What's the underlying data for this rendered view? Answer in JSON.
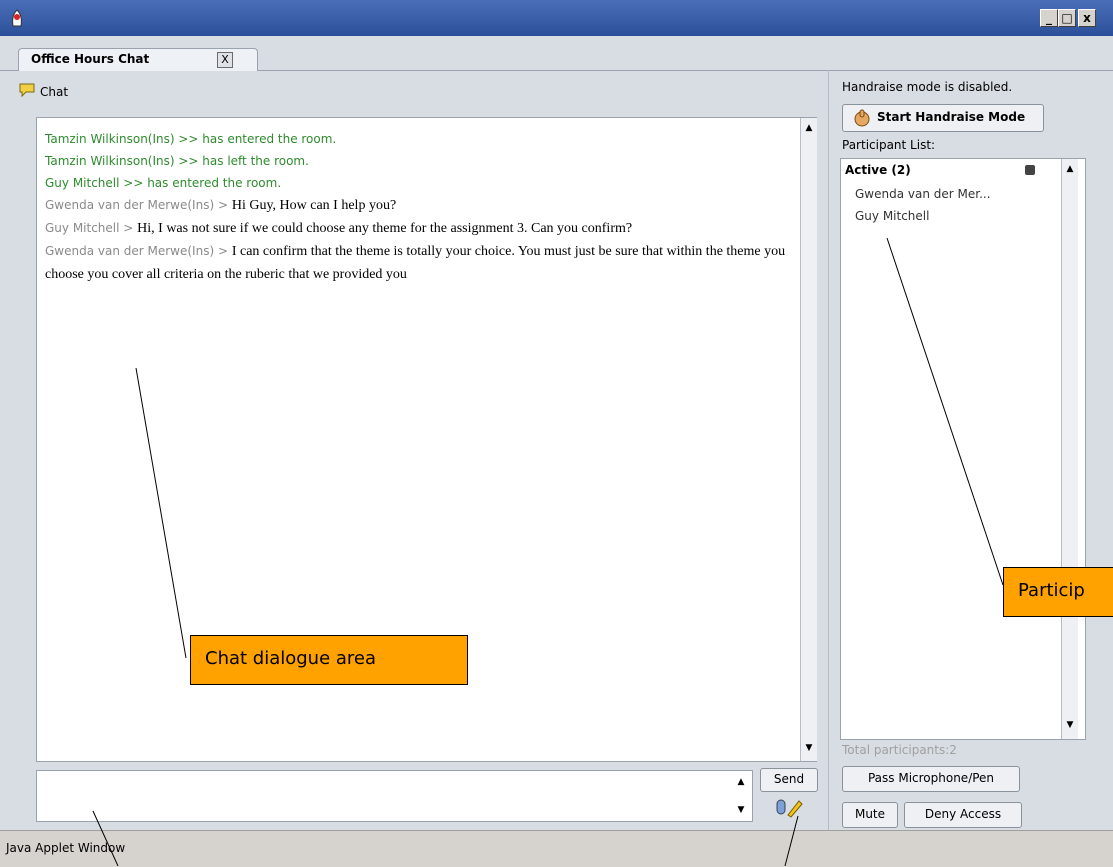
{
  "window": {
    "icons": {
      "app": "java-duke-icon",
      "minimize": "minimize-icon",
      "maximize": "maximize-icon",
      "close": "close-icon"
    },
    "minimize_label": "_",
    "maximize_label": "□",
    "close_label": "x"
  },
  "tab": {
    "label": "Office Hours Chat",
    "close_label": "X"
  },
  "chat": {
    "header": "Chat",
    "messages": [
      {
        "type": "system",
        "text": "Tamzin Wilkinson(Ins) >> has entered the room."
      },
      {
        "type": "system",
        "text": "Tamzin Wilkinson(Ins) >> has left the room."
      },
      {
        "type": "system",
        "text": "Guy Mitchell >> has entered the room."
      },
      {
        "type": "user",
        "sender": "Gwenda van der Merwe(Ins) > ",
        "text": "Hi Guy, How can I help you?"
      },
      {
        "type": "user",
        "sender": "Guy Mitchell > ",
        "text": "Hi, I was not sure if we could choose any theme for the assignment 3. Can you confirm?"
      },
      {
        "type": "user",
        "sender": "Gwenda van der Merwe(Ins) > ",
        "text": "I can confirm that the theme is totally your choice. You must just be sure that within the theme you choose you cover all criteria on the ruberic that we provided you"
      }
    ],
    "input_value": "",
    "send_label": "Send"
  },
  "right_panel": {
    "handraise_status": "Handraise mode is disabled.",
    "handraise_button": "Start Handraise Mode",
    "participant_list_title": "Participant List:",
    "active_header": "Active (2)",
    "participants": [
      "Gwenda van der Mer...",
      "Guy Mitchell"
    ],
    "total_participants": "Total participants:2",
    "pass_button": "Pass Microphone/Pen",
    "mute_button": "Mute",
    "deny_button": "Deny Access"
  },
  "status_bar": {
    "text": "Java Applet Window"
  },
  "annotations": {
    "chat_area": "Chat dialogue area",
    "participant_list": "Particip"
  },
  "colors": {
    "system_message": "#2e8b2e",
    "sender_name": "#8a8a8a",
    "callout": "#ffa200",
    "titlebar": "#2c4f9a"
  }
}
